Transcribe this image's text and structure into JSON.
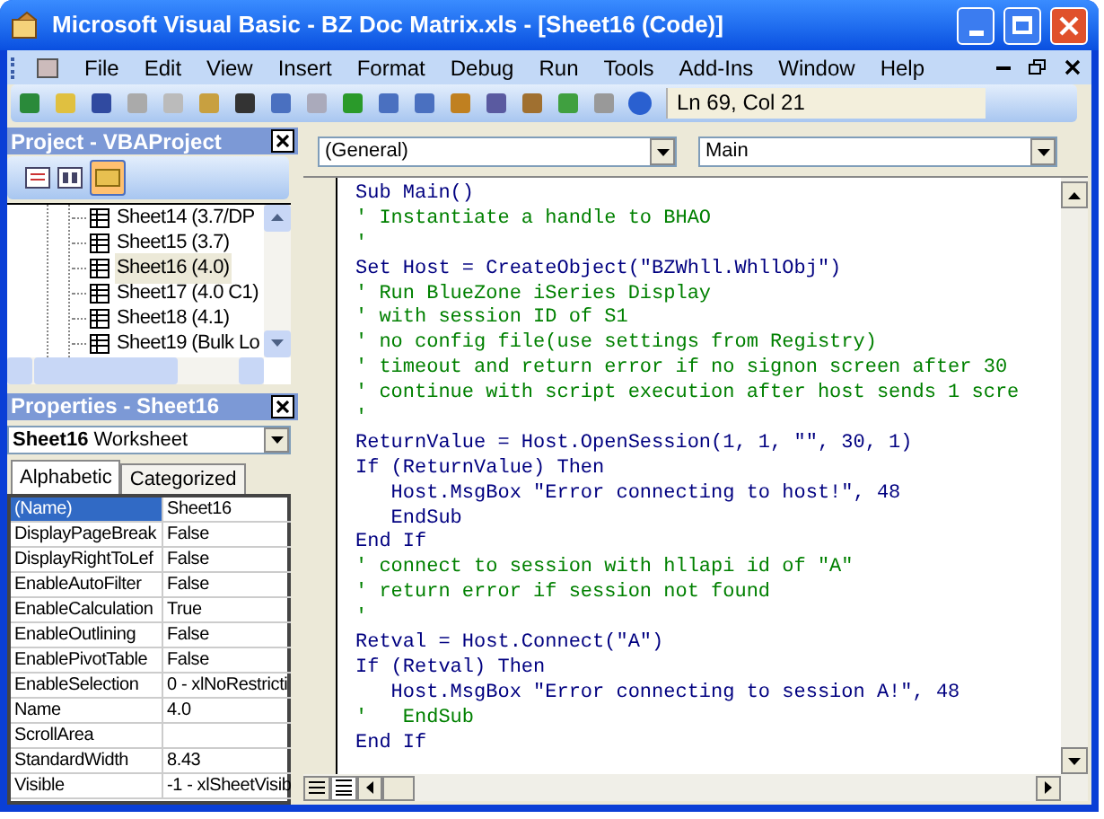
{
  "window": {
    "title": "Microsoft Visual Basic - BZ Doc Matrix.xls - [Sheet16 (Code)]"
  },
  "menu": [
    "File",
    "Edit",
    "View",
    "Insert",
    "Format",
    "Debug",
    "Run",
    "Tools",
    "Add-Ins",
    "Window",
    "Help"
  ],
  "toolbar": {
    "position": "Ln 69, Col 21"
  },
  "project": {
    "title": "Project - VBAProject",
    "folders_toggled": true,
    "items": [
      {
        "label": "Sheet14 (3.7/DP",
        "selected": false
      },
      {
        "label": "Sheet15 (3.7)",
        "selected": false
      },
      {
        "label": "Sheet16 (4.0)",
        "selected": true
      },
      {
        "label": "Sheet17 (4.0 C1)",
        "selected": false
      },
      {
        "label": "Sheet18 (4.1)",
        "selected": false
      },
      {
        "label": "Sheet19 (Bulk Lo",
        "selected": false
      }
    ]
  },
  "properties": {
    "title": "Properties - Sheet16",
    "object": {
      "name": "Sheet16",
      "type": "Worksheet"
    },
    "tabs": [
      {
        "label": "Alphabetic",
        "selected": true
      },
      {
        "label": "Categorized",
        "selected": false
      }
    ],
    "rows": [
      {
        "name": "(Name)",
        "value": "Sheet16",
        "selected": true
      },
      {
        "name": "DisplayPageBreak",
        "value": "False",
        "selected": false
      },
      {
        "name": "DisplayRightToLef",
        "value": "False",
        "selected": false
      },
      {
        "name": "EnableAutoFilter",
        "value": "False",
        "selected": false
      },
      {
        "name": "EnableCalculation",
        "value": "True",
        "selected": false
      },
      {
        "name": "EnableOutlining",
        "value": "False",
        "selected": false
      },
      {
        "name": "EnablePivotTable",
        "value": "False",
        "selected": false
      },
      {
        "name": "EnableSelection",
        "value": "0 - xlNoRestricti",
        "selected": false
      },
      {
        "name": "Name",
        "value": "4.0",
        "selected": false
      },
      {
        "name": "ScrollArea",
        "value": "",
        "selected": false
      },
      {
        "name": "StandardWidth",
        "value": "8.43",
        "selected": false
      },
      {
        "name": "Visible",
        "value": "-1 - xlSheetVisib",
        "selected": false
      }
    ]
  },
  "code": {
    "object": "(General)",
    "procedure": "Main",
    "lines": [
      {
        "kind": "code",
        "text": "Sub Main()"
      },
      {
        "kind": "comment",
        "text": "' Instantiate a handle to BHAO"
      },
      {
        "kind": "comment",
        "text": "'"
      },
      {
        "kind": "code",
        "text": "Set Host = CreateObject(\"BZWhll.WhllObj\")"
      },
      {
        "kind": "comment",
        "text": "' Run BlueZone iSeries Display"
      },
      {
        "kind": "comment",
        "text": "' with session ID of S1"
      },
      {
        "kind": "comment",
        "text": "' no config file(use settings from Registry)"
      },
      {
        "kind": "comment",
        "text": "' timeout and return error if no signon screen after 30"
      },
      {
        "kind": "comment",
        "text": "' continue with script execution after host sends 1 scre"
      },
      {
        "kind": "comment",
        "text": "'"
      },
      {
        "kind": "code",
        "text": "ReturnValue = Host.OpenSession(1, 1, \"\", 30, 1)"
      },
      {
        "kind": "code",
        "text": "If (ReturnValue) Then"
      },
      {
        "kind": "code",
        "text": "   Host.MsgBox \"Error connecting to host!\", 48"
      },
      {
        "kind": "code",
        "text": "   EndSub"
      },
      {
        "kind": "code",
        "text": "End If"
      },
      {
        "kind": "comment",
        "text": "' connect to session with hllapi id of \"A\""
      },
      {
        "kind": "comment",
        "text": "' return error if session not found"
      },
      {
        "kind": "comment",
        "text": "'"
      },
      {
        "kind": "code",
        "text": "Retval = Host.Connect(\"A\")"
      },
      {
        "kind": "code",
        "text": "If (Retval) Then"
      },
      {
        "kind": "code",
        "text": "   Host.MsgBox \"Error connecting to session A!\", 48"
      },
      {
        "kind": "comment",
        "text": "'   EndSub"
      },
      {
        "kind": "code",
        "text": "End If"
      }
    ]
  }
}
